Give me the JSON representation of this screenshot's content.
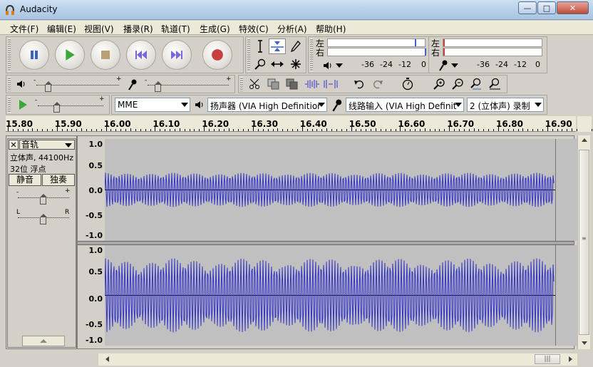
{
  "window": {
    "title": "Audacity",
    "controls": {
      "minimize": "—",
      "maximize": "□",
      "close": "✕"
    }
  },
  "menu": [
    "文件(F)",
    "编辑(E)",
    "视图(V)",
    "播录(R)",
    "轨道(T)",
    "生成(G)",
    "特效(C)",
    "分析(A)",
    "帮助(H)"
  ],
  "transport": {
    "icons": [
      "pause-icon",
      "play-icon",
      "stop-icon",
      "skip-start-icon",
      "skip-end-icon",
      "record-icon"
    ]
  },
  "tools": [
    "selection-tool-icon",
    "envelope-tool-icon",
    "draw-tool-icon",
    "zoom-tool-icon",
    "timeshift-tool-icon",
    "multi-tool-icon"
  ],
  "meters": {
    "playback": {
      "left": "左",
      "right": "右",
      "ticks": [
        "-36",
        "-24",
        "-12",
        "0"
      ]
    },
    "record": {
      "left": "左",
      "right": "右",
      "ticks": [
        "-36",
        "-24",
        "-12",
        "0"
      ]
    }
  },
  "device": {
    "host": "MME",
    "output": "扬声器 (VIA High Definitior",
    "input": "线路输入 (VIA High Definit",
    "channels": "2 (立体声) 录制"
  },
  "ruler": {
    "labels": [
      "15.80",
      "15.90",
      "16.00",
      "16.10",
      "16.20",
      "16.30",
      "16.40",
      "16.50",
      "16.60",
      "16.70",
      "16.80",
      "16.90"
    ]
  },
  "track": {
    "name": "音轨",
    "format": "立体声, 44100Hz",
    "bitdepth": "32位 浮点",
    "mute": "静音",
    "solo": "独奏",
    "gain_minus": "-",
    "gain_plus": "+",
    "pan_left": "L",
    "pan_right": "R"
  },
  "scale": {
    "top": [
      "1.0",
      "0.5",
      "0.0",
      "-0.5",
      "-1.0"
    ],
    "bottom": [
      "1.0",
      "0.5",
      "0.0",
      "-0.5",
      "-1.0"
    ]
  },
  "scrollbar": {
    "grip": "|||"
  },
  "colors": {
    "waveform": "#3232c8",
    "wave_bg": "#c0c0c0",
    "record": "#c84040",
    "play": "#3aa83a"
  }
}
